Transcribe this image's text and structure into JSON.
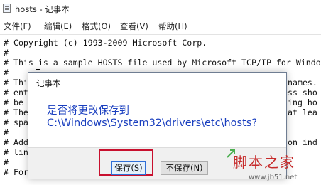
{
  "window": {
    "title": "hosts - 记事本"
  },
  "menu": [
    "文件(F)",
    "编辑(E)",
    "格式(O)",
    "查看(V)",
    "帮助(H)"
  ],
  "editor": {
    "lines": [
      "# Copyright (c) 1993-2009 Microsoft Corp.",
      "#",
      "# This is a sample HOSTS file used by Microsoft TCP/IP for Windo",
      "#",
      "# This",
      "# entry",
      "# be pl",
      "# The I",
      "# space",
      "#",
      "# Addit",
      "# lines",
      "#",
      "# For e"
    ],
    "right_fragments": [
      "names.",
      "ess sho",
      "ding ho",
      "at lea",
      "on ind"
    ]
  },
  "dialog": {
    "title": "记事本",
    "message_line1": "是否将更改保存到",
    "message_line2": "C:\\Windows\\System32\\drivers\\etc\\hosts?",
    "save_label": "保存(S)",
    "dont_save_label": "不保存(N)"
  },
  "watermark": {
    "text": "脚本之家",
    "url": "www.jb51.net"
  },
  "colors": {
    "dialog_text": "#1a3fbf",
    "highlight": "#c8102e",
    "watermark": "#c62a2a"
  }
}
